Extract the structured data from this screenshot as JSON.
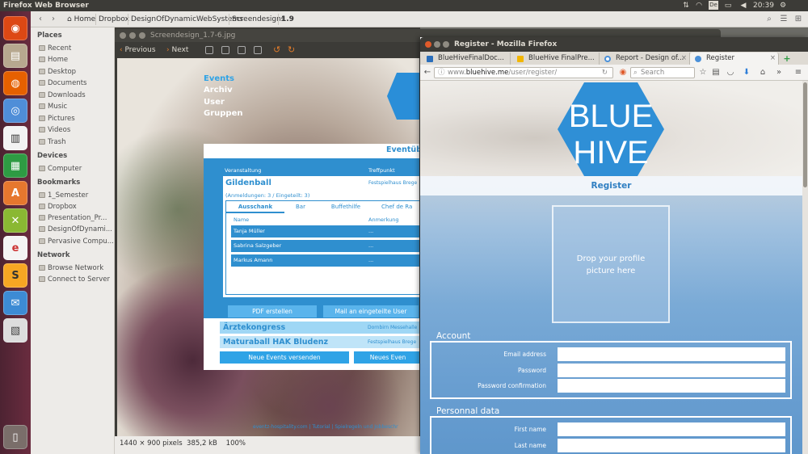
{
  "top_panel": {
    "app_title": "Firefox Web Browser",
    "clock": "20:39",
    "keyboard": "De"
  },
  "nautilus": {
    "crumbs": [
      "Home",
      "Dropbox",
      "DesignOfDynamicWebSystems",
      "Screendesigns",
      "1.9"
    ],
    "sections": {
      "places": {
        "title": "Places",
        "items": [
          "Recent",
          "Home",
          "Desktop",
          "Documents",
          "Downloads",
          "Music",
          "Pictures",
          "Videos",
          "Trash"
        ]
      },
      "devices": {
        "title": "Devices",
        "items": [
          "Computer"
        ]
      },
      "bookmarks": {
        "title": "Bookmarks",
        "items": [
          "1_Semester",
          "Dropbox",
          "Presentation_Pr...",
          "DesignOfDynami...",
          "Pervasive Compu..."
        ]
      },
      "network": {
        "title": "Network",
        "items": [
          "Browse Network",
          "Connect to Server"
        ]
      }
    }
  },
  "eog": {
    "title": "Screendesign_1.7-6.jpg",
    "previous": "Previous",
    "next": "Next",
    "status_dims": "1440 × 900 pixels",
    "status_size": "385,2 kB",
    "status_zoom": "100%"
  },
  "mockup": {
    "nav": [
      "Events",
      "Archiv",
      "User",
      "Gruppen"
    ],
    "panel_title": "Eventüb",
    "col_veranstaltung": "Veranstaltung",
    "col_treffpunkt": "Treffpunkt",
    "event1": {
      "name": "Gildenball",
      "place": "Festspielhaus Brege",
      "sub": "(Anmeldungen: 3 / Eingeteilt: 3)"
    },
    "tabs": [
      "Ausschank",
      "Bar",
      "Buffethilfe",
      "Chef de Ra"
    ],
    "col_name": "Name",
    "col_anmerkung": "Anmerkung",
    "people": [
      {
        "name": "Tanja Müller",
        "note": "..."
      },
      {
        "name": "Sabrina Salzgeber",
        "note": "..."
      },
      {
        "name": "Markus Amann",
        "note": "..."
      }
    ],
    "btn_pdf": "PDF erstellen",
    "btn_mail": "Mail an eingeteilte User",
    "event2": {
      "name": "Ärztekongress",
      "place": "Dornbirn Messehalle"
    },
    "event3": {
      "name": "Maturaball HAK Bludenz",
      "place": "Festspielhaus Brege"
    },
    "btn_neue": "Neue Events versenden",
    "btn_neue2": "Neues Even",
    "footer": "eventz-hospitality.com  |  Tutorial  |  Spielregeln und Jobbeschr"
  },
  "firefox": {
    "window_title": "Register - Mozilla Firefox",
    "tabs": [
      {
        "label": "BlueHiveFinalDoc...",
        "color": "#2a6ebb"
      },
      {
        "label": "BlueHive FinalPre...",
        "color": "#f2b600"
      },
      {
        "label": "Report - Design of...",
        "color": "#4a90d9"
      },
      {
        "label": "Register",
        "color": "#4a90d9"
      }
    ],
    "url_prefix": "www.",
    "url_host": "bluehive.me",
    "url_path": "/user/register/",
    "search_placeholder": "Search"
  },
  "register": {
    "logo_line1": "BLUE",
    "logo_line2": "HIVE",
    "heading": "Register",
    "dropzone": "Drop your profile picture here",
    "account_title": "Account",
    "email_label": "Email address",
    "password_label": "Password",
    "confirm_label": "Password confirmation",
    "personal_title": "Personnal data",
    "first_name_label": "First name",
    "last_name_label": "Last name"
  },
  "colors": {
    "accent": "#2f8fcf",
    "brand": "#3a8fd2",
    "ubuntu_orange": "#dd4814"
  }
}
